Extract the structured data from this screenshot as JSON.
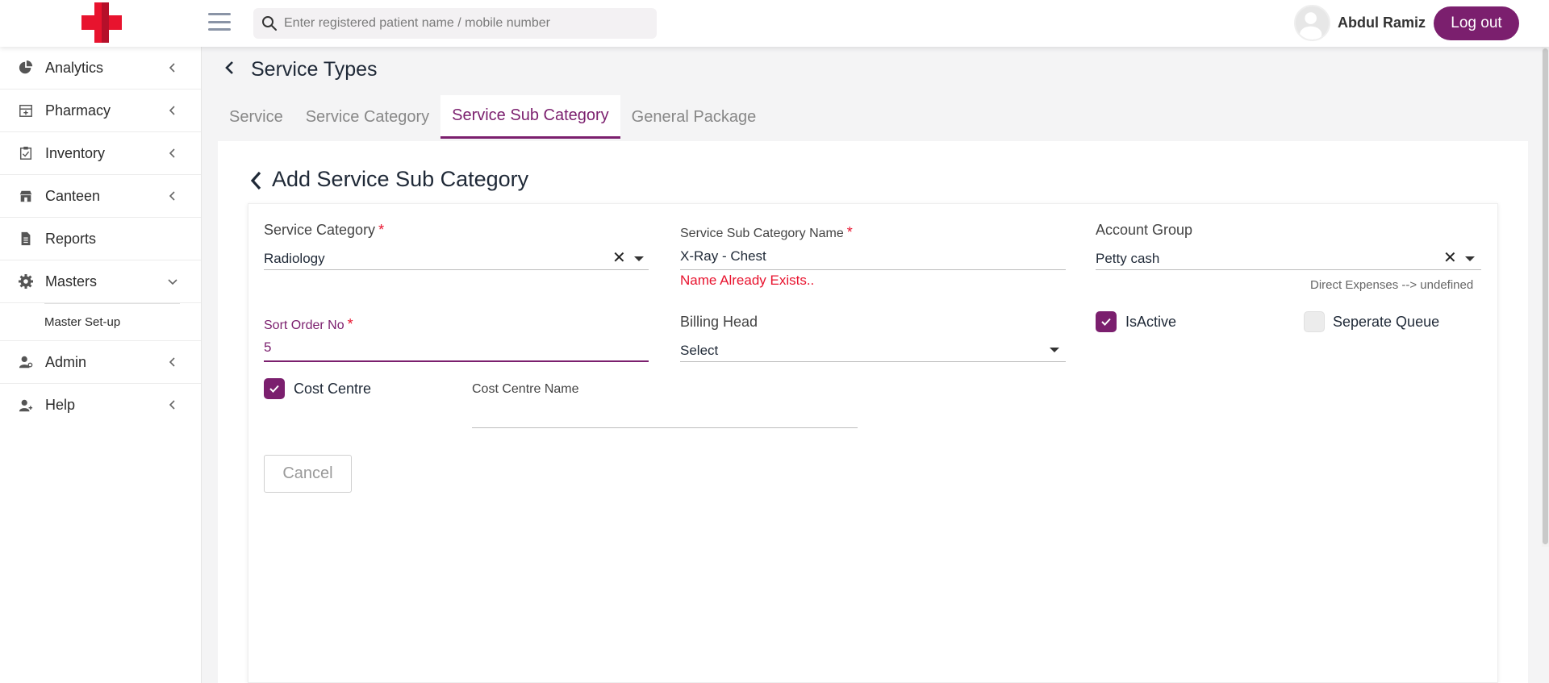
{
  "header": {
    "search_placeholder": "Enter registered patient name / mobile number",
    "user_name": "Abdul Ramiz",
    "logout_label": "Log out"
  },
  "sidebar": {
    "items": [
      {
        "label": "Analytics",
        "icon": "pie-chart-icon"
      },
      {
        "label": "Pharmacy",
        "icon": "pharmacy-icon"
      },
      {
        "label": "Inventory",
        "icon": "clipboard-icon"
      },
      {
        "label": "Canteen",
        "icon": "store-icon"
      },
      {
        "label": "Reports",
        "icon": "report-icon"
      },
      {
        "label": "Masters",
        "icon": "gear-icon"
      },
      {
        "label": "Admin",
        "icon": "user-gear-icon"
      },
      {
        "label": "Help",
        "icon": "user-plus-icon"
      }
    ],
    "masters_sub": [
      "Master Set-up"
    ]
  },
  "page": {
    "title": "Service Types",
    "tabs": [
      "Service",
      "Service Category",
      "Service Sub Category",
      "General Package"
    ],
    "active_tab": "Service Sub Category"
  },
  "form": {
    "title": "Add Service Sub Category",
    "service_category": {
      "label": "Service Category",
      "required": "*",
      "value": "Radiology"
    },
    "sub_category_name": {
      "label": "Service Sub Category Name",
      "required": "*",
      "value": "X-Ray - Chest",
      "error": "Name Already Exists.."
    },
    "account_group": {
      "label": "Account Group",
      "value": "Petty cash",
      "hint": "Direct Expenses --> undefined"
    },
    "sort_order": {
      "label": "Sort Order No",
      "required": "*",
      "value": "5"
    },
    "billing_head": {
      "label": "Billing Head",
      "value": "Select"
    },
    "is_active": {
      "label": "IsActive",
      "checked": true
    },
    "separate_queue": {
      "label": "Seperate Queue",
      "checked": false
    },
    "cost_centre": {
      "label": "Cost Centre",
      "checked": true
    },
    "cost_centre_name": {
      "label": "Cost Centre Name",
      "value": ""
    },
    "cancel_label": "Cancel"
  },
  "colors": {
    "brand": "#7b1f6e",
    "error": "#e8132e",
    "logo": "#e8132e"
  }
}
